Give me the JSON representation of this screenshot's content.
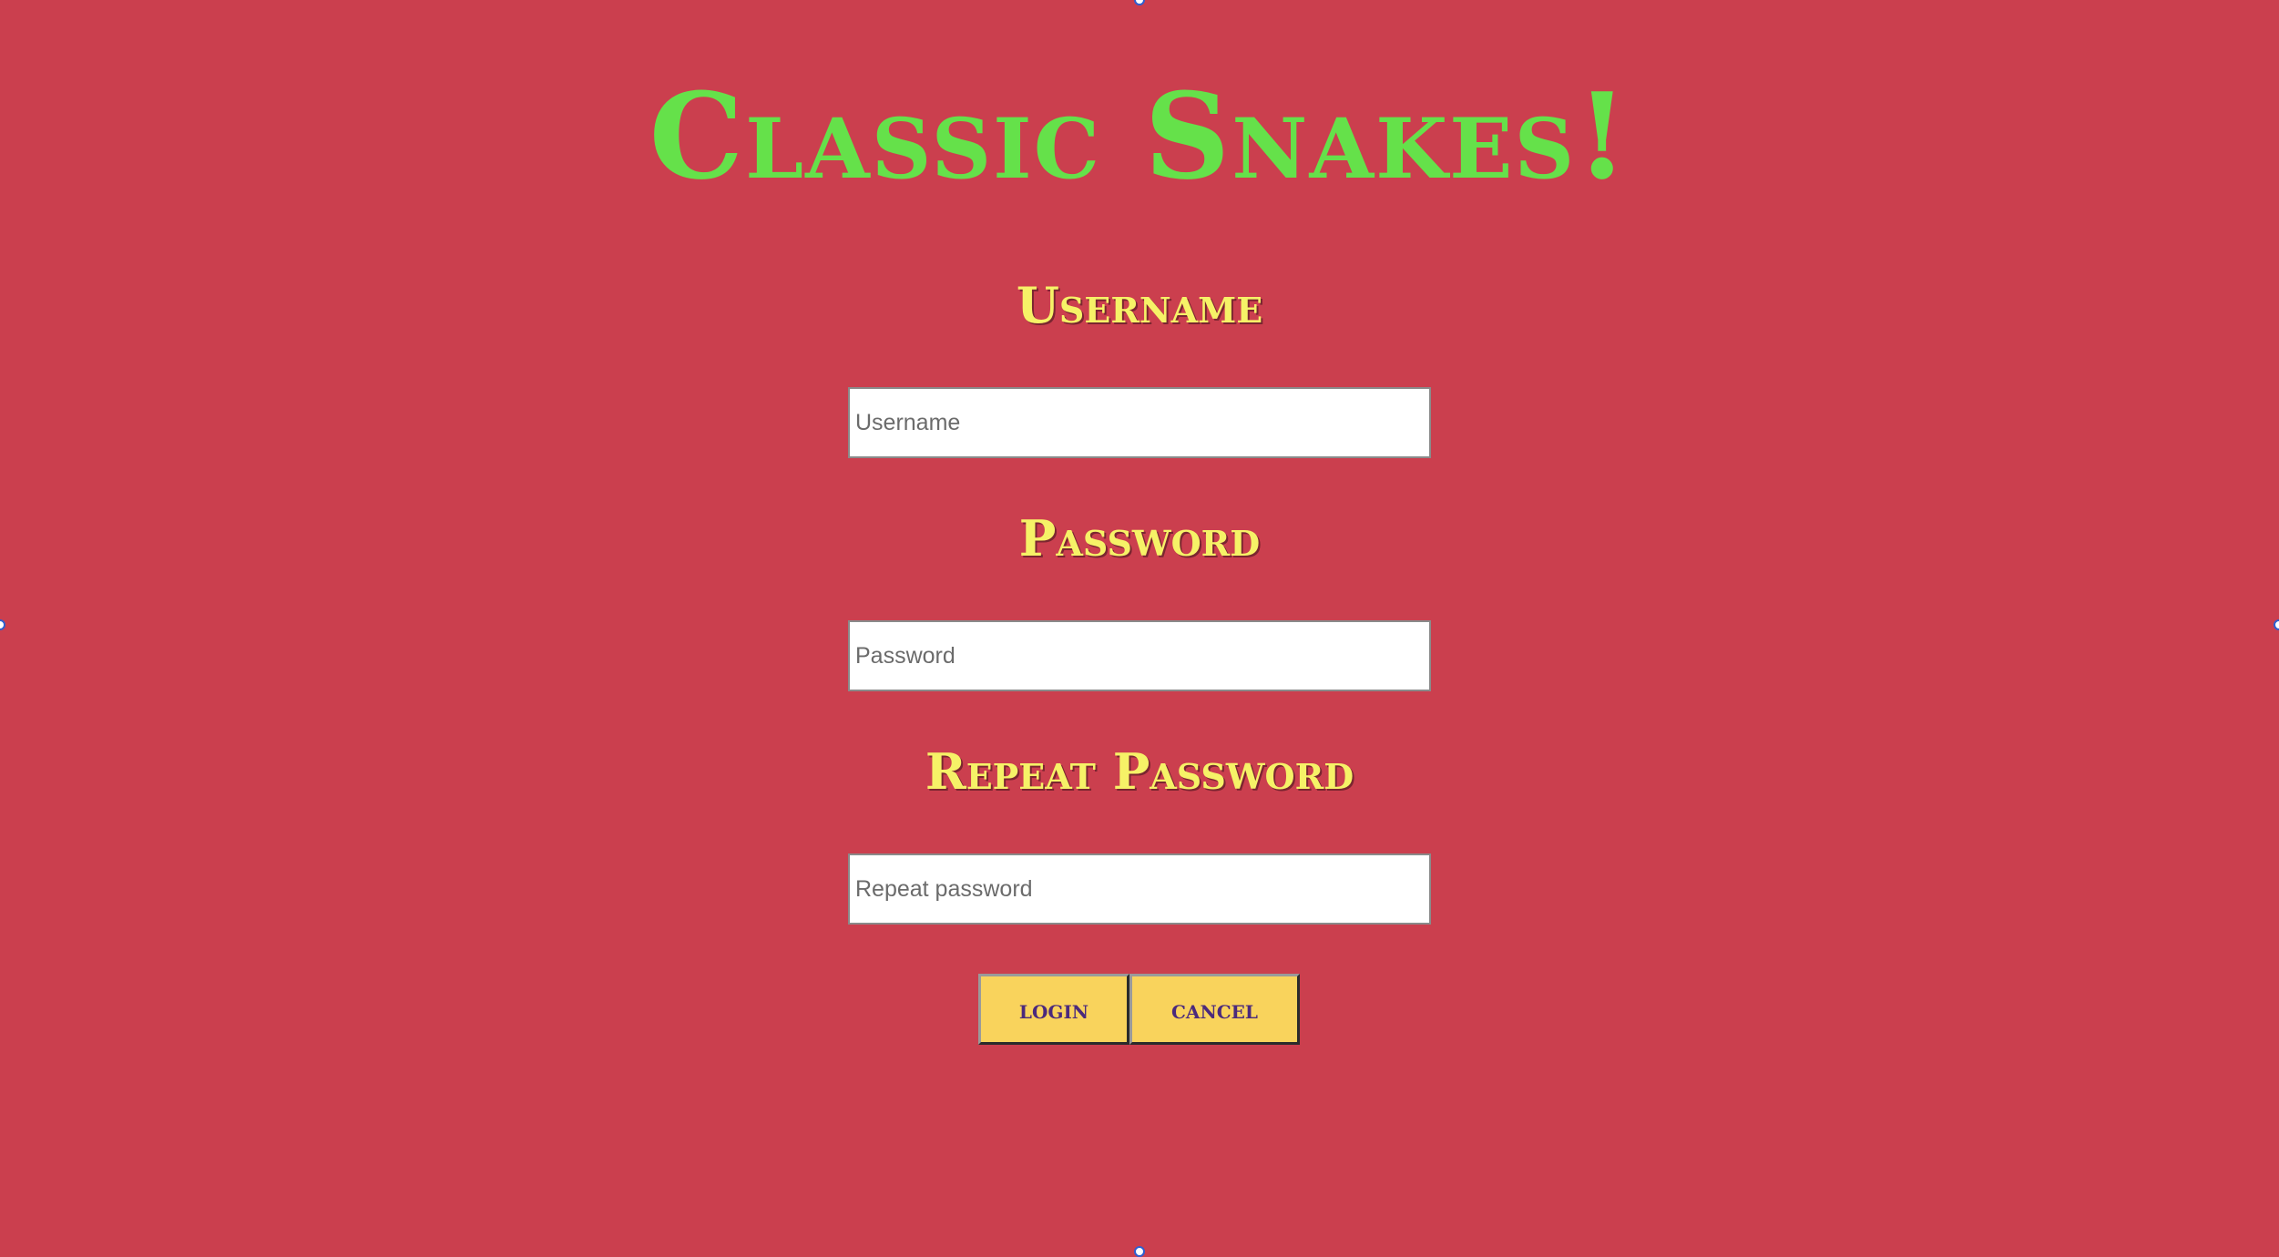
{
  "page": {
    "title": "Classic Snakes!",
    "background_color": "#cb3f4e",
    "title_color": "#65e14a",
    "label_color": "#f6f267"
  },
  "form": {
    "username_label": "Username",
    "username_placeholder": "Username",
    "username_value": "",
    "password_label": "Password",
    "password_placeholder": "Password",
    "password_value": "",
    "repeat_label": "Repeat Password",
    "repeat_placeholder": "Repeat password",
    "repeat_value": ""
  },
  "buttons": {
    "login_label": "login",
    "cancel_label": "cancel",
    "button_color": "#f9d35c",
    "button_text_color": "#4b2a7c"
  },
  "selection_handles": {
    "color": "#2d5fd0",
    "icon": "resize-handle-icon"
  }
}
